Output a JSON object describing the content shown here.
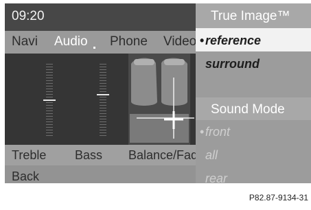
{
  "status": {
    "time": "09:20"
  },
  "tabs": [
    {
      "label": "Navi",
      "active": false
    },
    {
      "label": "Audio",
      "active": true
    },
    {
      "label": "Phone",
      "active": false
    },
    {
      "label": "Video",
      "active": false
    }
  ],
  "bottom": {
    "treble": "Treble",
    "bass": "Bass",
    "balance": "Balance/Fader",
    "back": "Back"
  },
  "panel": {
    "true_image": "True Image™",
    "items": [
      {
        "label": "reference",
        "selected": true
      },
      {
        "label": "surround",
        "selected": false
      }
    ],
    "sound_mode": "Sound Mode",
    "modes": [
      {
        "label": "front",
        "selected": true
      },
      {
        "label": "all",
        "selected": false
      },
      {
        "label": "rear",
        "selected": false
      }
    ]
  },
  "ref_code": "P82.87-9134-31"
}
